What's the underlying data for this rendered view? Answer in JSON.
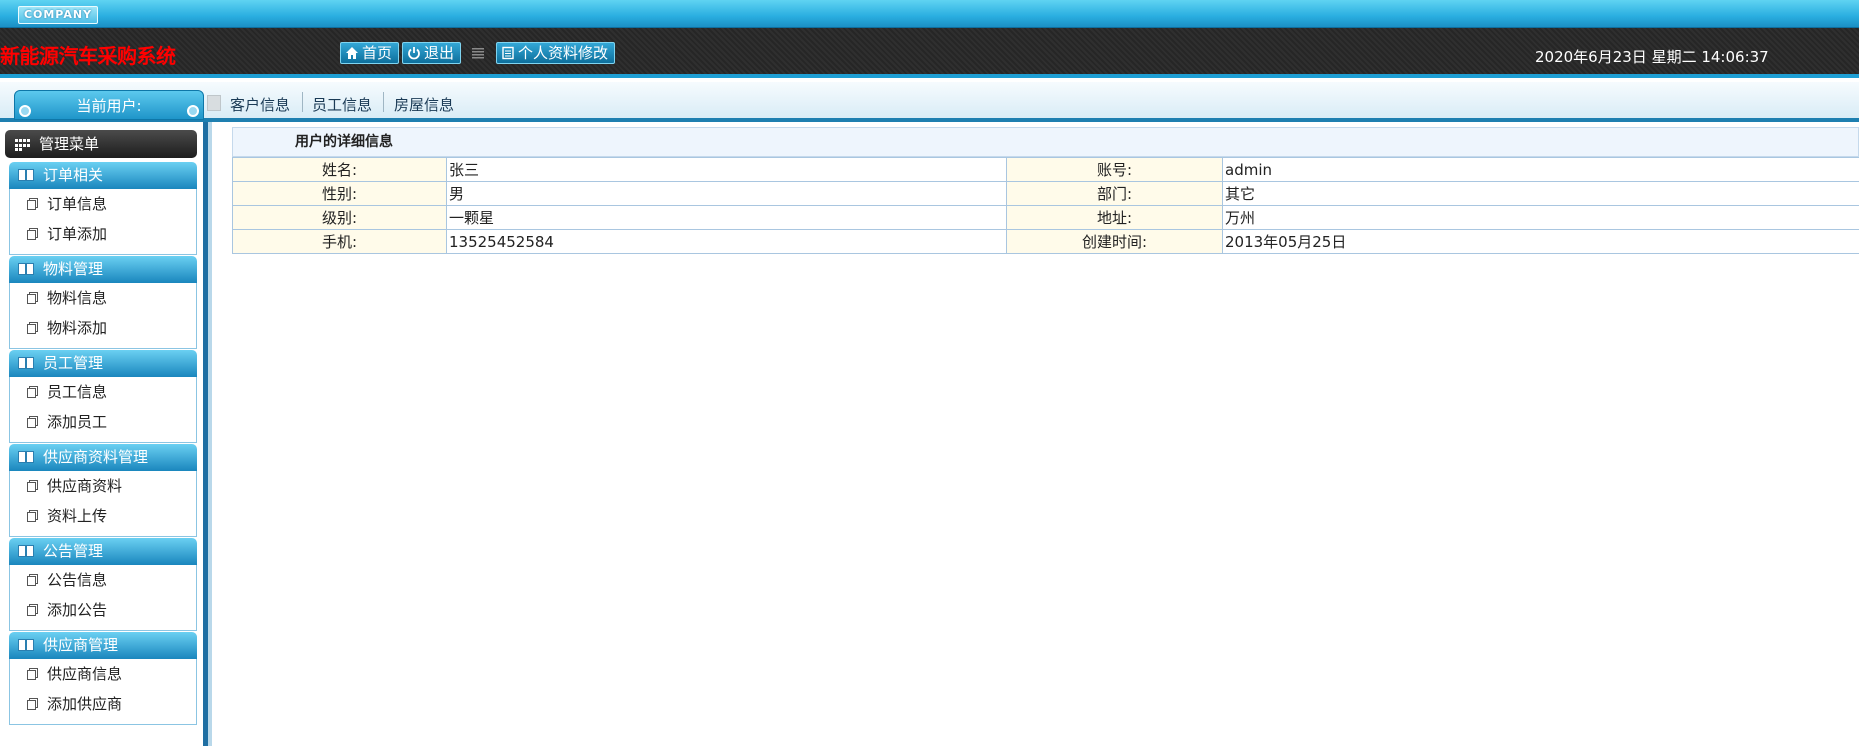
{
  "header": {
    "logo_text": "COMPANY",
    "app_title": "新能源汽车采购系统",
    "buttons": {
      "home": "首页",
      "logout": "退出",
      "profile_edit": "个人资料修改"
    },
    "datetime": "2020年6月23日  星期二  14:06:37"
  },
  "subbar": {
    "current_user_label": "当前用户:",
    "links": [
      "客户信息",
      "员工信息",
      "房屋信息"
    ]
  },
  "sidebar": {
    "menu_title": "管理菜单",
    "groups": [
      {
        "title": "订单相关",
        "items": [
          "订单信息",
          "订单添加"
        ]
      },
      {
        "title": "物料管理",
        "items": [
          "物料信息",
          "物料添加"
        ]
      },
      {
        "title": "员工管理",
        "items": [
          "员工信息",
          "添加员工"
        ]
      },
      {
        "title": "供应商资料管理",
        "items": [
          "供应商资料",
          "资料上传"
        ]
      },
      {
        "title": "公告管理",
        "items": [
          "公告信息",
          "添加公告"
        ]
      },
      {
        "title": "供应商管理",
        "items": [
          "供应商信息",
          "添加供应商"
        ]
      }
    ]
  },
  "detail": {
    "title": "用户的详细信息",
    "rows": [
      {
        "l1": "姓名:",
        "v1": "张三",
        "l2": "账号:",
        "v2": "admin"
      },
      {
        "l1": "性别:",
        "v1": "男",
        "l2": "部门:",
        "v2": "其它"
      },
      {
        "l1": "级别:",
        "v1": "一颗星",
        "l2": "地址:",
        "v2": "万州"
      },
      {
        "l1": "手机:",
        "v1": "13525452584",
        "l2": "创建时间:",
        "v2": "2013年05月25日"
      }
    ]
  },
  "colors": {
    "title_red": "#ff0000",
    "accent_blue": "#1e9fd4",
    "dark_header": "#2a2a2a"
  }
}
